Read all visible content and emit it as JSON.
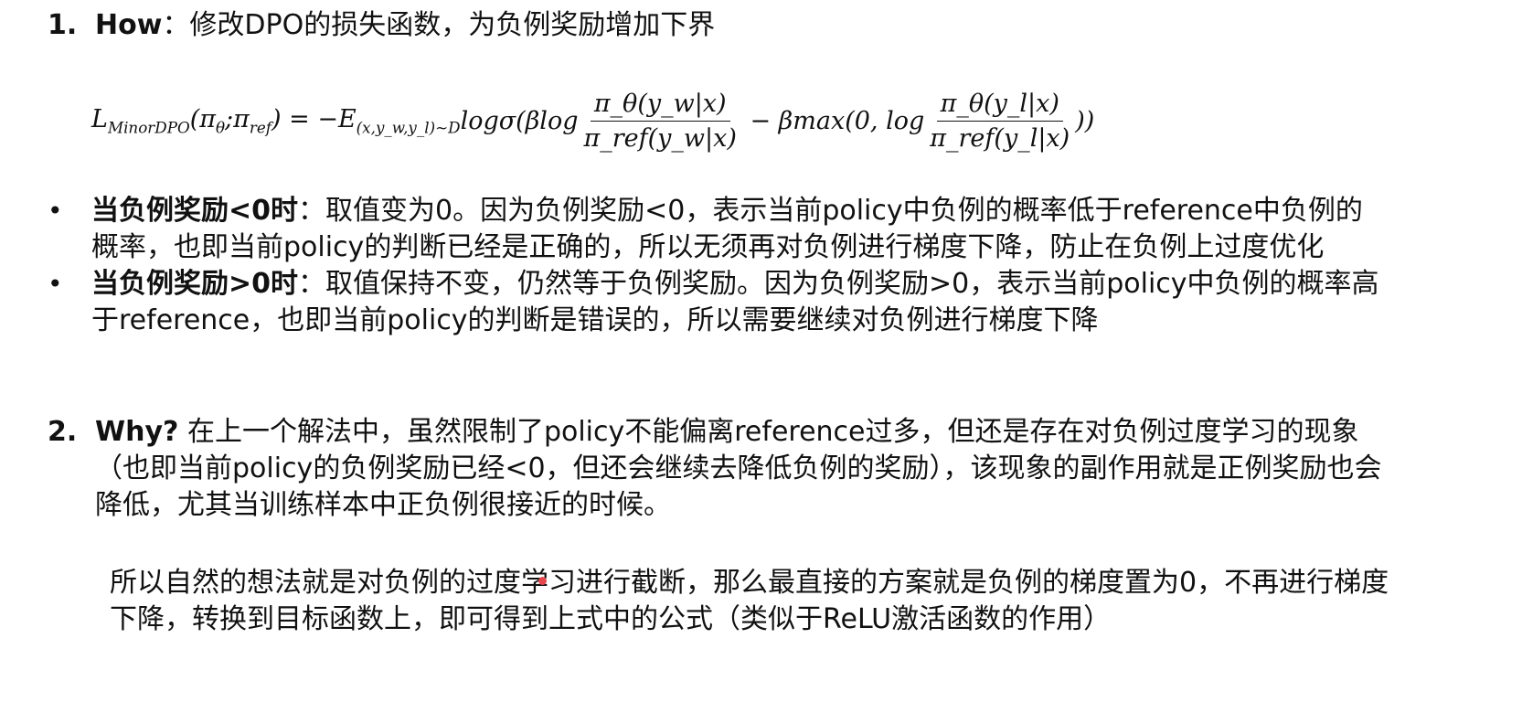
{
  "section1": {
    "number": "1.",
    "keyword": "How",
    "title": "：修改DPO的损失函数，为负例奖励增加下界"
  },
  "formula": {
    "lhs": "L",
    "lhs_sub": "MinorDPO",
    "args": "(π",
    "args_sub1": "θ",
    "args_mid": ";π",
    "args_sub2": "ref",
    "args_end": ") = −E",
    "e_sub": "(x,y_w,y_l)∼D",
    "log_sigma": "logσ(βlog",
    "frac1_num": "π_θ(y_w|x)",
    "frac1_den": "π_ref(y_w|x)",
    "mid": " − βmax(0, log",
    "frac2_num": "π_θ(y_l|x)",
    "frac2_den": "π_ref(y_l|x)",
    "end": "))"
  },
  "bullets": [
    {
      "marker": "•",
      "bold": "当负例奖励<0时",
      "text": "：取值变为0。因为负例奖励<0，表示当前policy中负例的概率低于reference中负例的概率，也即当前policy的判断已经是正确的，所以无须再对负例进行梯度下降，防止在负例上过度优化"
    },
    {
      "marker": "•",
      "bold": "当负例奖励>0时",
      "text": "：取值保持不变，仍然等于负例奖励。因为负例奖励>0，表示当前policy中负例的概率高于reference，也即当前policy的判断是错误的，所以需要继续对负例进行梯度下降"
    }
  ],
  "section2": {
    "number": "2.",
    "keyword": "Why?",
    "text": " 在上一个解法中，虽然限制了policy不能偏离reference过多，但还是存在对负例过度学习的现象（也即当前policy的负例奖励已经<0，但还会继续去降低负例的奖励），该现象的副作用就是正例奖励也会降低，尤其当训练样本中正负例很接近的时候。"
  },
  "conclusion": "所以自然的想法就是对负例的过度学习进行截断，那么最直接的方案就是负例的梯度置为0，不再进行梯度下降，转换到目标函数上，即可得到上式中的公式（类似于ReLU激活函数的作用）",
  "colors": {
    "pointer_dot": "#e5484d"
  }
}
